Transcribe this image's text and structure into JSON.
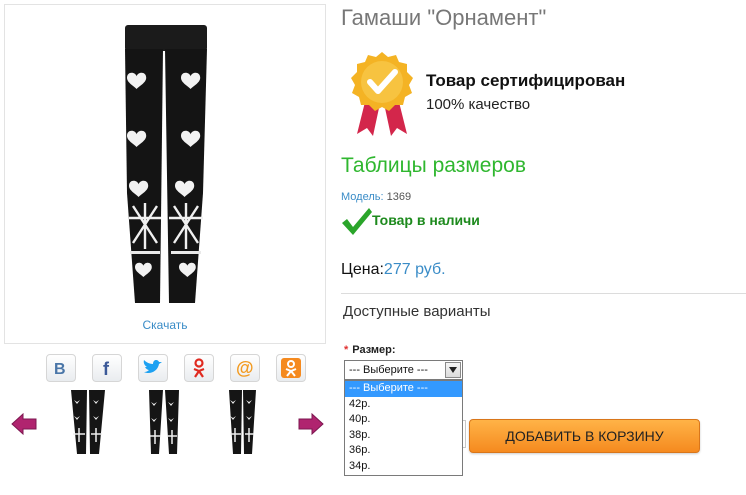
{
  "product": {
    "title": "Гамаши \"Орнамент\"",
    "download_label": "Скачать"
  },
  "certificate": {
    "title": "Товар сертифицирован",
    "subtitle": "100% качество"
  },
  "size_table_link": "Таблицы размеров",
  "model": {
    "label": "Модель:",
    "value": "1369"
  },
  "stock": {
    "text": "Товар в наличи"
  },
  "price": {
    "label": "Цена:",
    "value": "277 руб."
  },
  "variants": {
    "heading": "Доступные варианты",
    "required_mark": "*",
    "size_label": "Размер:",
    "selected": "--- Выберите ---",
    "options": [
      "--- Выберите ---",
      "42р.",
      "40р.",
      "38р.",
      "36р.",
      "34р."
    ]
  },
  "cart": {
    "add_label": "ДОБАВИТЬ В КОРЗИНУ"
  },
  "social": [
    "vkontakte-icon",
    "facebook-icon",
    "twitter-icon",
    "odnoklassniki-alt-icon",
    "mail-ru-icon",
    "odnoklassniki-icon"
  ],
  "colors": {
    "accent_green": "#2fb72f",
    "stock_green": "#1d8a1d",
    "link_blue": "#3a8cc7",
    "cart_orange": "#f58a1f",
    "nav_arrow": "#b0246f"
  }
}
